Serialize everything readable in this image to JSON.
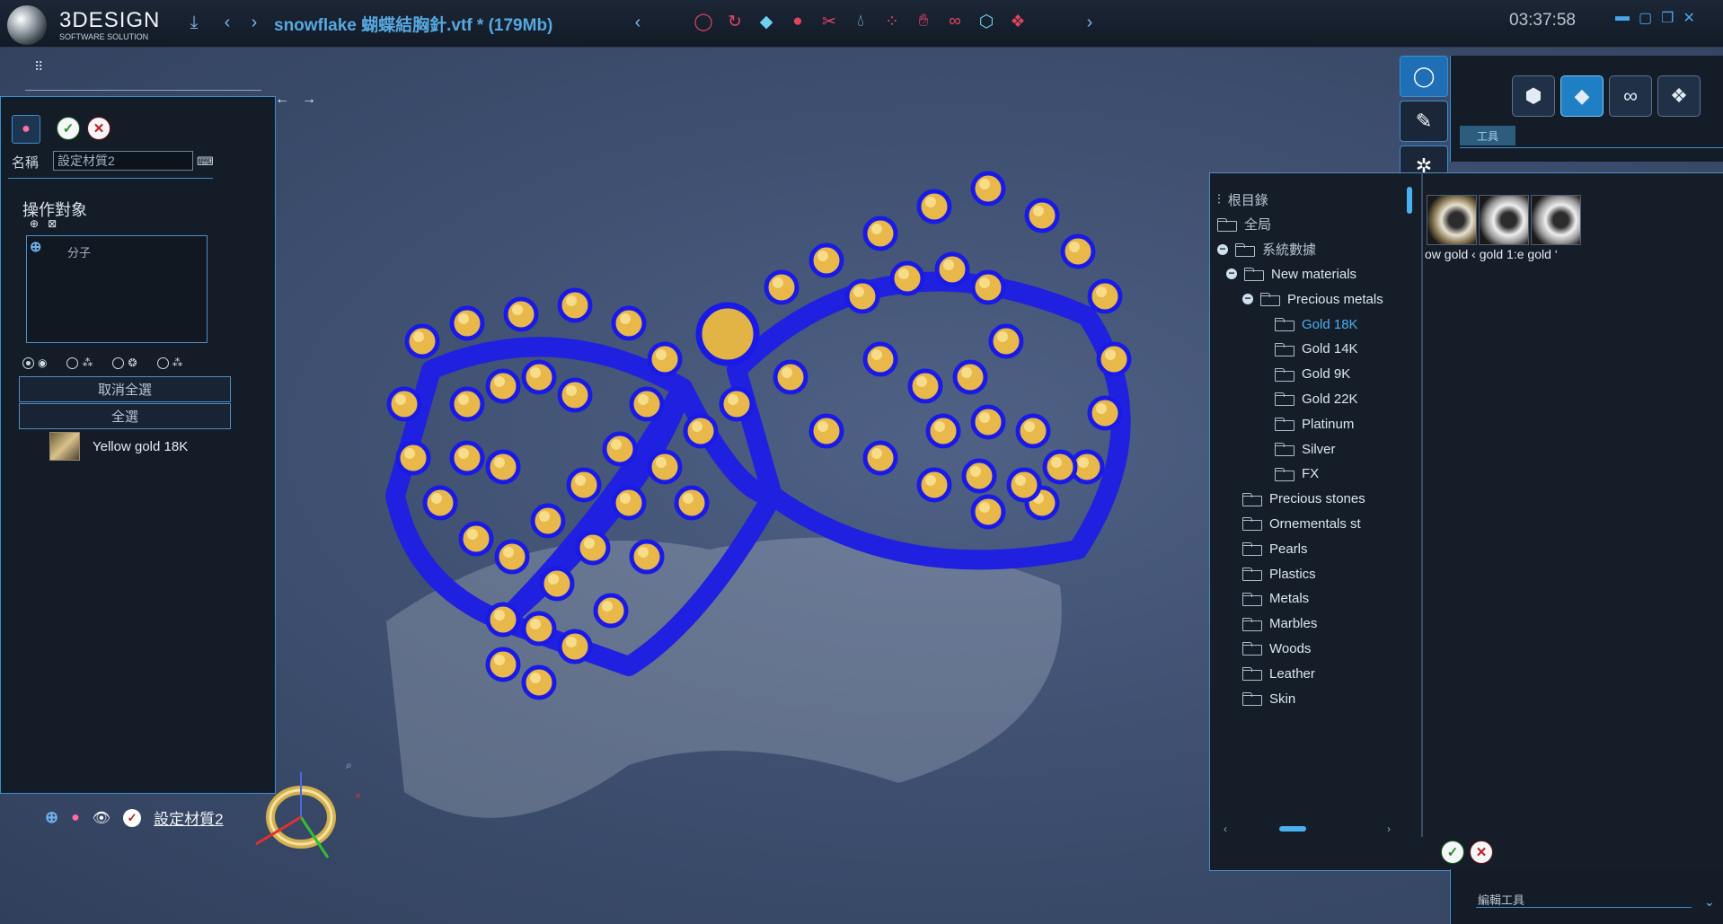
{
  "app": {
    "logo_main": "3DESIGN",
    "logo_sub": "SOFTWARE SOLUTION",
    "file_title": "snowflake 蝴蝶結胸針.vtf * (179Mb)",
    "clock": "03:37:58"
  },
  "toolbar": {
    "icons": [
      "ring-icon",
      "gear-ring-icon",
      "gem-icon",
      "material-icon",
      "cut-icon",
      "drop-icon",
      "dots-icon",
      "hand-icon",
      "link-icon",
      "cube-icon",
      "multi-gem-icon"
    ]
  },
  "left_panel": {
    "name_label": "名稱",
    "name_value": "設定材質2",
    "section_title": "操作對象",
    "object_box_text": "分子",
    "deselect_all": "取消全選",
    "select_all": "全選",
    "material_item": "Yellow gold 18K"
  },
  "bottom_bar": {
    "label": "設定材質2"
  },
  "right_panel": {
    "tab_label": "工具",
    "bottom_label": "編輯工具"
  },
  "browser": {
    "tree": [
      {
        "label": "根目錄",
        "level": 0,
        "kind": "root"
      },
      {
        "label": "全局",
        "level": 0,
        "kind": "folder"
      },
      {
        "label": "系統數據",
        "level": 1,
        "kind": "folder-open"
      },
      {
        "label": "New materials",
        "level": 2,
        "kind": "folder-open"
      },
      {
        "label": "Precious metals",
        "level": 3,
        "kind": "folder-open"
      },
      {
        "label": "Gold 18K",
        "level": 4,
        "kind": "folder",
        "selected": true
      },
      {
        "label": "Gold 14K",
        "level": 4,
        "kind": "folder"
      },
      {
        "label": "Gold 9K",
        "level": 4,
        "kind": "folder"
      },
      {
        "label": "Gold 22K",
        "level": 4,
        "kind": "folder"
      },
      {
        "label": "Platinum",
        "level": 4,
        "kind": "folder"
      },
      {
        "label": "Silver",
        "level": 4,
        "kind": "folder"
      },
      {
        "label": "FX",
        "level": 4,
        "kind": "folder"
      },
      {
        "label": "Precious stones",
        "level": 3,
        "kind": "folder"
      },
      {
        "label": "Ornementals st",
        "level": 3,
        "kind": "folder"
      },
      {
        "label": "Pearls",
        "level": 3,
        "kind": "folder"
      },
      {
        "label": "Plastics",
        "level": 3,
        "kind": "folder"
      },
      {
        "label": "Metals",
        "level": 3,
        "kind": "folder"
      },
      {
        "label": "Marbles",
        "level": 3,
        "kind": "folder"
      },
      {
        "label": "Woods",
        "level": 3,
        "kind": "folder"
      },
      {
        "label": "Leather",
        "level": 3,
        "kind": "folder"
      },
      {
        "label": "Skin",
        "level": 3,
        "kind": "folder"
      }
    ],
    "thumb_labels": "ow gold ‹ gold 1:e gold ‘"
  },
  "colors": {
    "accent": "#3a8fd0",
    "selected_text": "#4ab0f0",
    "model_blue": "#1a1ae6",
    "gem_gold": "#e8b84a"
  }
}
